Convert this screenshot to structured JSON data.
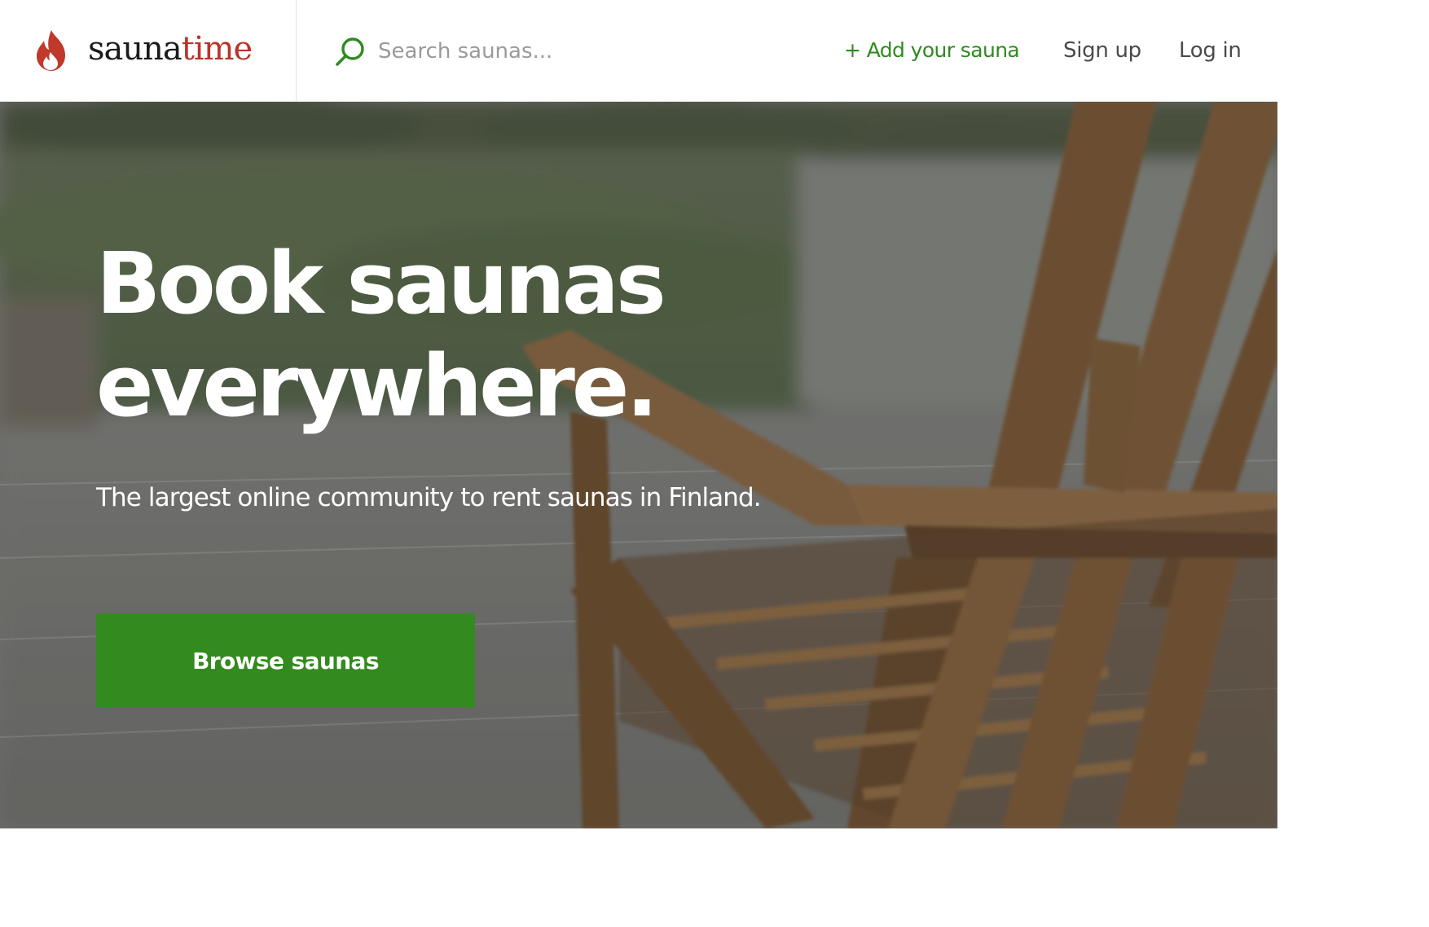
{
  "header": {
    "logo": {
      "part1": "sauna",
      "part2": "time",
      "icon": "flame-icon"
    },
    "search": {
      "placeholder": "Search saunas...",
      "value": "",
      "icon": "search-icon"
    },
    "nav": {
      "add_sauna": "+ Add your sauna",
      "sign_up": "Sign up",
      "log_in": "Log in"
    }
  },
  "hero": {
    "title_line1": "Book saunas",
    "title_line2": "everywhere.",
    "subtitle": "The largest online community to rent saunas in Finland.",
    "cta_label": "Browse saunas",
    "background": "blurred-deck-with-wooden-chair-photo"
  },
  "colors": {
    "brand_red": "#b8342a",
    "accent_green": "#338a1e",
    "link_green": "#2f8a1f",
    "nav_text": "#4a4a4a"
  }
}
